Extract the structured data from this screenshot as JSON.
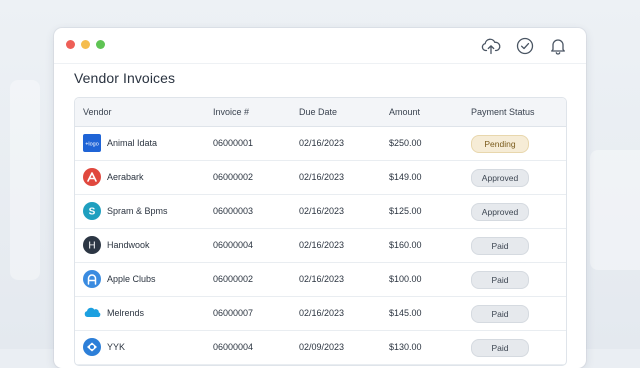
{
  "page": {
    "title": "Vendor Invoices"
  },
  "toolbar": {
    "icons": [
      "upload-cloud-icon",
      "check-circle-icon",
      "bell-icon"
    ]
  },
  "window_controls": {
    "close_color": "#ee5f57",
    "minimize_color": "#f5bd4f",
    "maximize_color": "#5fc454"
  },
  "table": {
    "columns": [
      "Vendor",
      "Invoice #",
      "Due Date",
      "Amount",
      "Payment Status"
    ],
    "rows": [
      {
        "vendor": "Animal Idata",
        "logo": "brand-logo-icon",
        "invoice": "06000001",
        "due": "02/16/2023",
        "amount": "$250.00",
        "status": "Pending",
        "status_kind": "pending"
      },
      {
        "vendor": "Aerabark",
        "logo": "aerabark-logo-icon",
        "invoice": "06000002",
        "due": "02/16/2023",
        "amount": "$149.00",
        "status": "Approved",
        "status_kind": "approved"
      },
      {
        "vendor": "Spram & Bpms",
        "logo": "spram-logo-icon",
        "invoice": "06000003",
        "due": "02/16/2023",
        "amount": "$125.00",
        "status": "Approved",
        "status_kind": "approved"
      },
      {
        "vendor": "Handwook",
        "logo": "handwook-logo-icon",
        "invoice": "06000004",
        "due": "02/16/2023",
        "amount": "$160.00",
        "status": "Paid",
        "status_kind": "paid"
      },
      {
        "vendor": "Apple Clubs",
        "logo": "apple-clubs-logo-icon",
        "invoice": "06000002",
        "due": "02/16/2023",
        "amount": "$100.00",
        "status": "Paid",
        "status_kind": "paid"
      },
      {
        "vendor": "Melrends",
        "logo": "cloud-logo-icon",
        "invoice": "06000007",
        "due": "02/16/2023",
        "amount": "$145.00",
        "status": "Paid",
        "status_kind": "paid"
      },
      {
        "vendor": "YYK",
        "logo": "yyk-logo-icon",
        "invoice": "06000004",
        "due": "02/09/2023",
        "amount": "$130.00",
        "status": "Paid",
        "status_kind": "paid"
      }
    ],
    "logo_text": "+logo"
  }
}
